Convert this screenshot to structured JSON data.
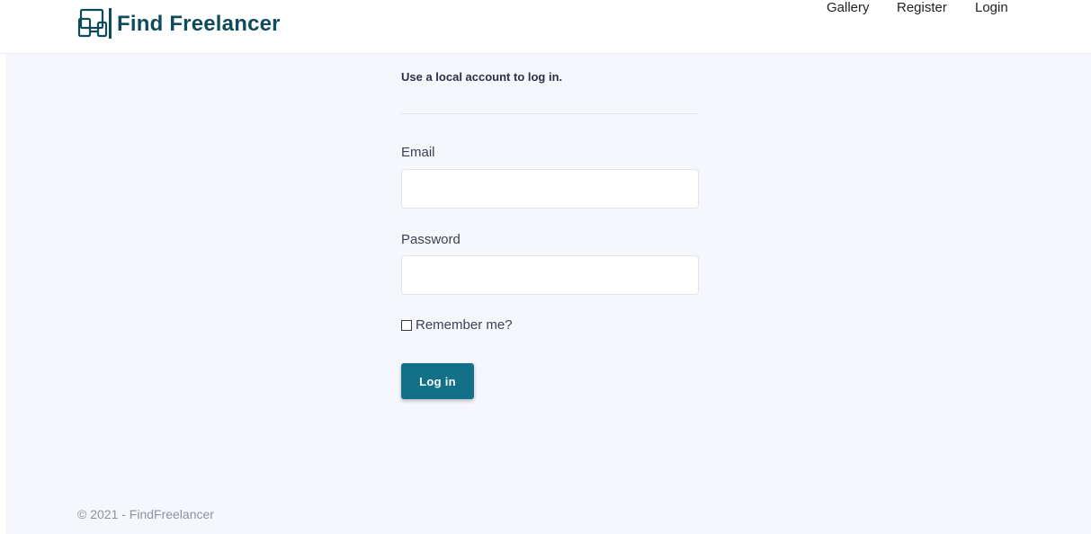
{
  "header": {
    "brand_name": "Find Freelancer",
    "brand_icon": "devices-icon",
    "nav": {
      "gallery": "Gallery",
      "register": "Register",
      "login": "Login"
    }
  },
  "login_form": {
    "heading": "Use a local account to log in.",
    "email_label": "Email",
    "email_value": "",
    "password_label": "Password",
    "password_value": "",
    "remember_label": "Remember me?",
    "remember_checked": false,
    "submit_label": "Log in"
  },
  "footer": {
    "text": "© 2021 - FindFreelancer"
  },
  "colors": {
    "brand": "#0e4c5c",
    "primary_button": "#127089",
    "page_background": "#f6f7fc"
  }
}
